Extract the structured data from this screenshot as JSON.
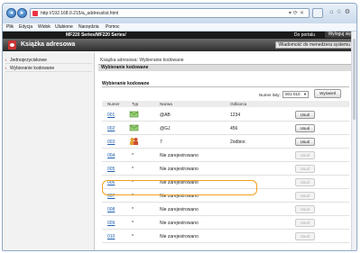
{
  "browser": {
    "url": "http://192.168.0.215/a_addresslist.html",
    "menu": [
      "Plik",
      "Edycja",
      "Widok",
      "Ulubione",
      "Narzędzia",
      "Pomoc"
    ]
  },
  "header": {
    "model": "MF220 Series/MF220 Series/",
    "portal": "Do portalu",
    "logout": "Wyloguj się",
    "title": "Książka adresowa",
    "status_link": "Wiadomość do menedżera systemu"
  },
  "sidebar": {
    "items": [
      {
        "label": "Jednoprzyciskowe"
      },
      {
        "label": "Wybieranie kodowane"
      }
    ]
  },
  "main": {
    "breadcrumb": "Książka adresowa: Wybieranie kodowane",
    "section_title": "Wybieranie kodowane",
    "subsection_title": "Wybieranie kodowane",
    "pager_label": "Numer listy:",
    "pager_value": "001-010",
    "show_button": "Wyświetl",
    "columns": {
      "number": "Numer",
      "type": "Typ",
      "name": "Nazwa",
      "destination": "Odbiorca"
    },
    "rows": [
      {
        "number": "001",
        "type": "email-icon",
        "name": "@AB",
        "destination": "1234",
        "delete": "Usuń",
        "active": true
      },
      {
        "number": "002",
        "type": "email-icon",
        "name": "@GJ",
        "destination": "456",
        "delete": "Usuń",
        "active": true
      },
      {
        "number": "003",
        "type": "group-icon",
        "name": "7",
        "destination": "2odbior.",
        "delete": "Usuń",
        "active": true
      },
      {
        "number": "004",
        "type": "*",
        "name": "Nie zarejestrowano",
        "destination": "",
        "delete": "Usuń",
        "active": false
      },
      {
        "number": "005",
        "type": "*",
        "name": "Nie zarejestrowano",
        "destination": "",
        "delete": "Usuń",
        "active": false
      },
      {
        "number": "006",
        "type": "*",
        "name": "Nie zarejestrowano",
        "destination": "",
        "delete": "Usuń",
        "active": false
      },
      {
        "number": "007",
        "type": "*",
        "name": "Nie zarejestrowano",
        "destination": "",
        "delete": "Usuń",
        "active": false
      },
      {
        "number": "008",
        "type": "*",
        "name": "Nie zarejestrowano",
        "destination": "",
        "delete": "Usuń",
        "active": false
      },
      {
        "number": "009",
        "type": "*",
        "name": "Nie zarejestrowano",
        "destination": "",
        "delete": "Usuń",
        "active": false
      },
      {
        "number": "010",
        "type": "*",
        "name": "Nie zarejestrowano",
        "destination": "",
        "delete": "Usuń",
        "active": false
      }
    ]
  },
  "colors": {
    "highlight": "#f0a21e",
    "link": "#1f5fb0",
    "header_dark": "#1a1a1a"
  }
}
